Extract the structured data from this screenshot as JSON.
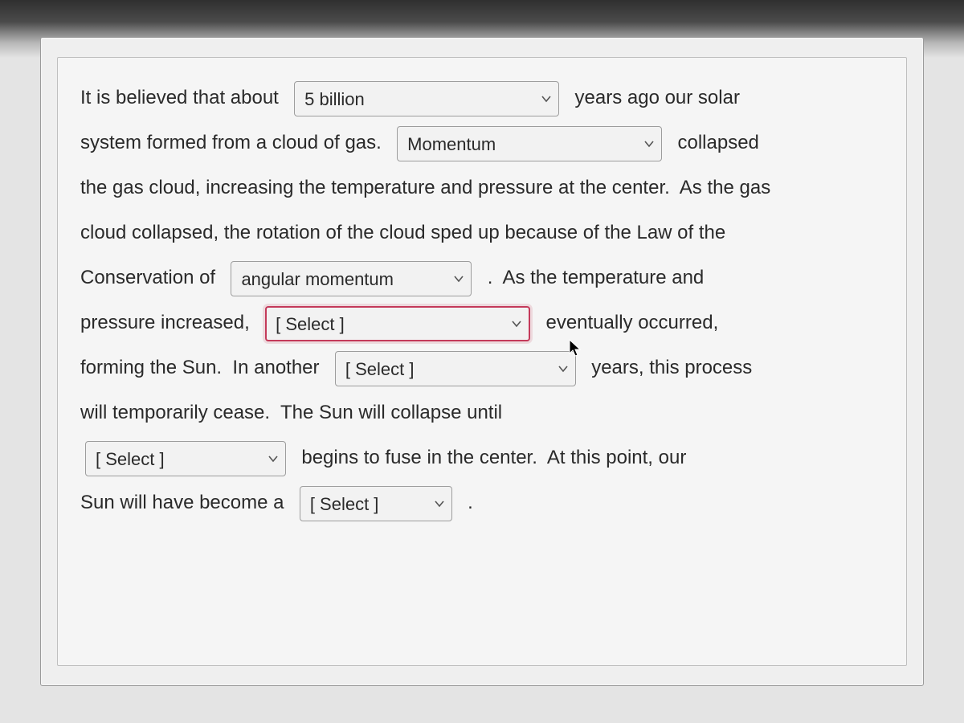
{
  "text": {
    "t1": "It is believed that about ",
    "t2": " years ago our solar",
    "t3": "system formed from a cloud of gas. ",
    "t4": " collapsed",
    "t5": "the gas cloud, increasing the temperature and pressure at the center.  As the gas",
    "t6": "cloud collapsed, the rotation of the cloud sped up because of the Law of the",
    "t7": "Conservation of ",
    "t8": " .  As the temperature and",
    "t9": "pressure increased, ",
    "t10": " eventually occurred,",
    "t11": "forming the Sun.  In another ",
    "t12": " years, this process",
    "t13": "will temporarily cease.  The Sun will collapse until",
    "t14": " begins to fuse in the center.  At this point, our",
    "t15": "Sun will have become a ",
    "t16": " ."
  },
  "selects": {
    "s1": {
      "value": "5 billion"
    },
    "s2": {
      "value": "Momentum"
    },
    "s3": {
      "value": "angular momentum"
    },
    "s4": {
      "value": "[ Select ]"
    },
    "s5": {
      "value": "[ Select ]"
    },
    "s6": {
      "value": "[ Select ]"
    },
    "s7": {
      "value": "[ Select ]"
    }
  },
  "icons": {
    "chevron": "chevron-down-icon",
    "cursor": "cursor-icon"
  }
}
